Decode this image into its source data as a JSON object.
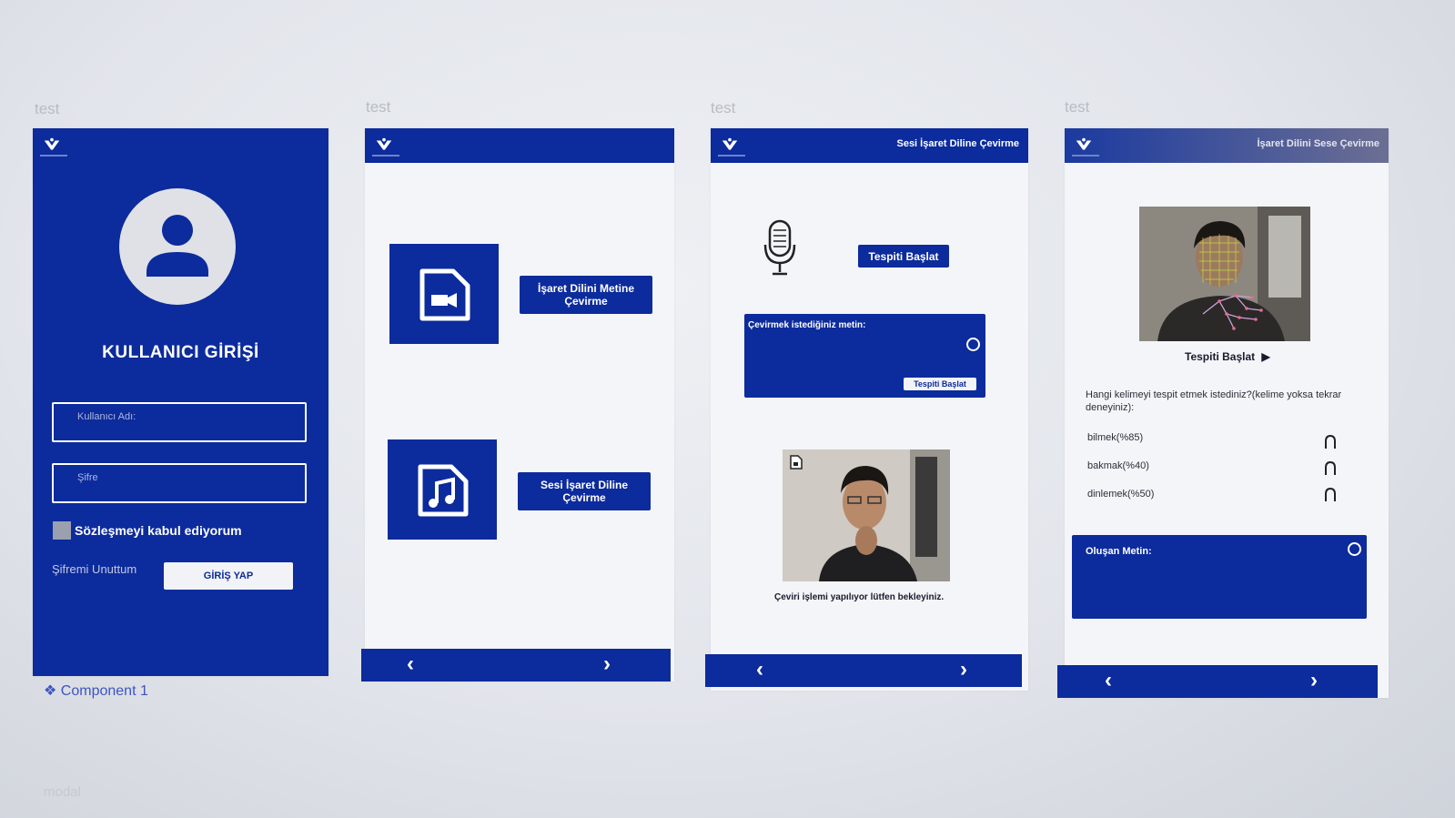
{
  "frame_labels": [
    "test",
    "test",
    "test",
    "test"
  ],
  "login": {
    "title": "KULLANICI GİRİŞİ",
    "username_placeholder": "Kullanıcı Adı:",
    "password_placeholder": "Şifre",
    "agreement_label": "Sözleşmeyi kabul ediyorum",
    "forgot_label": "Şifremi Unuttum",
    "submit_label": "GİRİŞ YAP"
  },
  "component_label": "❖ Component 1",
  "modal_label": "modal",
  "home": {
    "sign_to_text_label": "İşaret Dilini Metine Çevirme",
    "speech_to_sign_label": "Sesi İşaret Diline Çevirme"
  },
  "speech_screen": {
    "header_title": "Sesi İşaret Diline Çevirme",
    "start_button": "Tespiti Başlat",
    "input_label": "Çevirmek istediğiniz metin:",
    "inner_button": "Tespiti Başlat",
    "processing_caption": "Çeviri işlemi yapılıyor lütfen bekleyiniz."
  },
  "sign_screen": {
    "header_title": "İşaret Dilini Sese Çevirme",
    "start_detection": "Tespiti Başlat",
    "question": "Hangi kelimeyi tespit etmek istediniz?(kelime yoksa tekrar deneyiniz):",
    "options": [
      {
        "label": "bilmek(%85)",
        "icon": "headphones-icon"
      },
      {
        "label": "bakmak(%40)",
        "icon": "headphones-icon"
      },
      {
        "label": "dinlemek(%50)",
        "icon": "headphones-icon"
      }
    ],
    "output_label": "Oluşan Metin:"
  },
  "nav": {
    "prev": "‹",
    "next": "›"
  },
  "colors": {
    "primary": "#0c2b9c",
    "background": "#f4f5f8"
  }
}
